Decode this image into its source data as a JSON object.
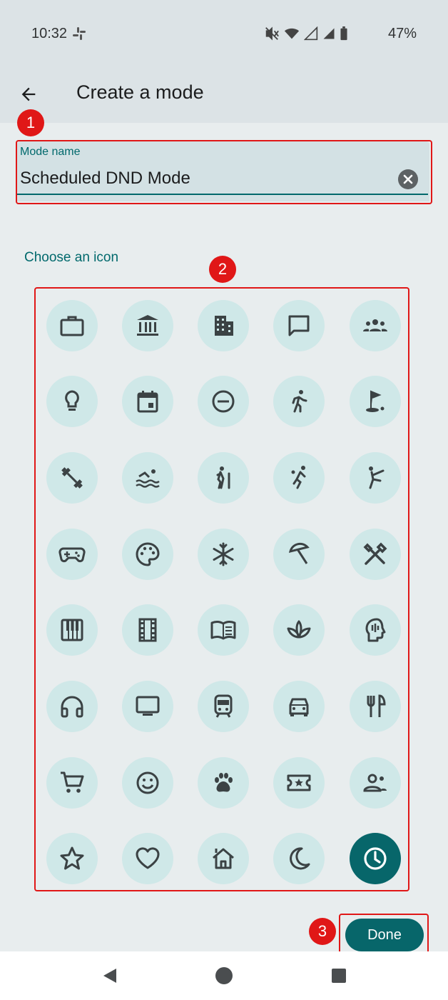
{
  "status_bar": {
    "time": "10:32",
    "battery": "47%"
  },
  "app_bar": {
    "title": "Create a mode"
  },
  "mode_name_field": {
    "label": "Mode name",
    "value": "Scheduled DND Mode"
  },
  "icon_section": {
    "label": "Choose an icon",
    "selected_icon": "clock-icon"
  },
  "icons": [
    [
      "briefcase-icon",
      "bank-icon",
      "office-building-icon",
      "chat-bubble-icon",
      "groups-icon"
    ],
    [
      "lightbulb-icon",
      "calendar-icon",
      "do-not-disturb-icon",
      "running-icon",
      "golf-icon"
    ],
    [
      "fitness-dumbbell-icon",
      "swimming-icon",
      "hiking-icon",
      "sports-handball-icon",
      "martial-arts-icon"
    ],
    [
      "gamepad-icon",
      "palette-icon",
      "snowflake-icon",
      "beach-umbrella-icon",
      "tools-icon"
    ],
    [
      "piano-icon",
      "film-icon",
      "book-icon",
      "spa-lotus-icon",
      "psychology-head-icon"
    ],
    [
      "headphones-icon",
      "tv-icon",
      "train-icon",
      "car-icon",
      "restaurant-icon"
    ],
    [
      "shopping-cart-icon",
      "smiley-icon",
      "paw-icon",
      "ticket-icon",
      "person-card-icon"
    ],
    [
      "star-icon",
      "heart-icon",
      "house-icon",
      "moon-icon",
      "clock-icon"
    ]
  ],
  "annotations": [
    "1",
    "2",
    "3"
  ],
  "done_button": {
    "label": "Done"
  },
  "colors": {
    "accent": "#00696c",
    "icon_bg": "#cfe8e8",
    "selected_bg": "#07666a",
    "annotation_red": "#e01717",
    "page_bg": "#e8edee"
  }
}
